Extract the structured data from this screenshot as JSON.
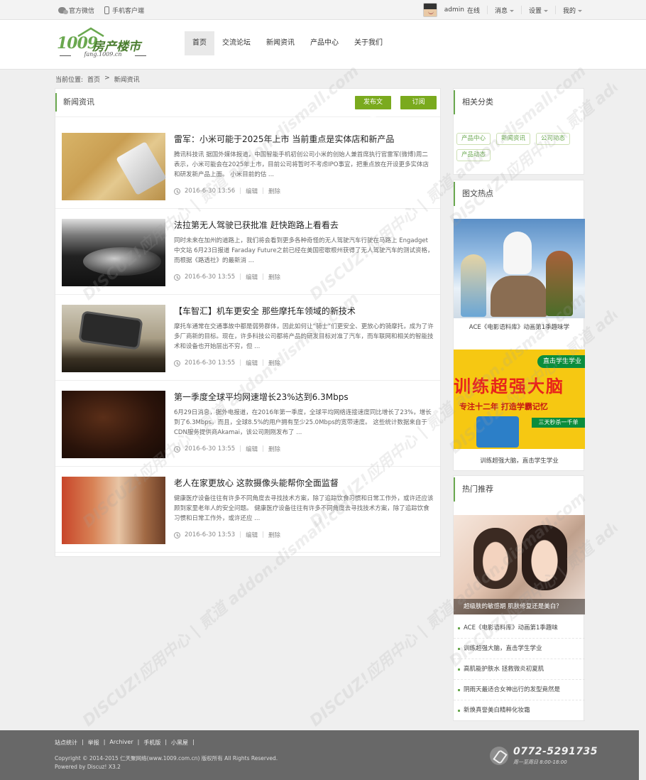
{
  "topbar": {
    "wechat": "官方微信",
    "mobile": "手机客户端",
    "username": "admin",
    "status": "在线",
    "messages": "消息",
    "settings": "设置",
    "mine": "我的"
  },
  "header": {
    "logo_main": "1009",
    "logo_cn": "房产楼市",
    "logo_sub": "fang.1009.cn",
    "nav": [
      "首页",
      "交流论坛",
      "新闻资讯",
      "产品中心",
      "关于我们"
    ]
  },
  "breadcrumb": {
    "label": "当前位置:",
    "home": "首页",
    "current": "新闻资讯",
    "sep": ">"
  },
  "main": {
    "title": "新闻资讯",
    "publish_button": "发布文章",
    "subscribe_button": "订阅",
    "edit": "编辑",
    "delete": "删除",
    "articles": [
      {
        "title": "雷军：小米可能于2025年上市 当前重点是实体店和新产品",
        "summary": "腾讯科技讯 据国外媒体报道，中国智能手机初创公司小米的创始人兼首席执行官雷军(微博)周二表示，小米可能会在2025年上市，目前公司将暂时不考虑IPO事宜，把重点放在开设更多实体店和研发新产品上面。 小米目前的估 ...",
        "time": "2016-6-30 13:56"
      },
      {
        "title": "法拉第无人驾驶已获批准 赶快跑路上看看去",
        "summary": "同时未来在加州的道路上，我们将会看到更多各种奇怪的无人驾驶汽车行驶在马路上 Engadget中文站 6月23日报道 Faraday Future之前已经在美国密歇根州获得了无人驾驶汽车的测试资格，而根据《路透社》的最新消 ...",
        "time": "2016-6-30 13:55"
      },
      {
        "title": "【车智汇】机车更安全 那些摩托车领域的新技术",
        "summary": "摩托车通常在交通事故中都是弱势群体，因此如何让“骑士”们更安全、更放心的骑摩托，成为了许多厂商新的目标。现在，许多科技公司都将产品的研发目标对准了汽车，而车联网和相关的智能技术和设备也开始层出不穷，但 ...",
        "time": "2016-6-30 13:55"
      },
      {
        "title": "第一季度全球平均网速增长23%达到6.3Mbps",
        "summary": "6月29日消息，据外电报道，在2016年第一季度，全球平均网络连接速度同比增长了23%，增长到了6.3Mbps。而且，全球8.5%的用户拥有至少25.0Mbps的宽带速度。 这些统计数据来自于CDN服务提供商Akamai，该公司刚刚发布了 ...",
        "time": "2016-6-30 13:55"
      },
      {
        "title": "老人在家更放心 这款摄像头能帮你全面监督",
        "summary": "健康医疗设备往往有许多不同角度去寻找技术方案，除了追踪饮食习惯和日常工作外，或许还应该顾到家里老年人的安全问题。 健康医疗设备往往有许多不同角度去寻找技术方案，除了追踪饮食习惯和日常工作外，或许还应 ...",
        "time": "2016-6-30 13:53"
      }
    ]
  },
  "sidebar": {
    "related_title": "相关分类",
    "tags": [
      "产品中心",
      "新闻资讯",
      "公司动态",
      "产品动态"
    ],
    "picture_title": "图文热点",
    "pictures": [
      {
        "caption": "ACE《电影语料库》动画第1季趣味学"
      },
      {
        "caption": "训练超强大脑，直击学生学业",
        "banner_line1": "训练超强大脑",
        "banner_line2": "专注十二年  打造学霸记忆",
        "banner_tag": "直击学生学业",
        "banner_small": "三天秒杀一千单"
      }
    ],
    "hot_title": "热门推荐",
    "hot_image_caption": "超级肤的敏感期 肌肤修复还是美白？",
    "hot_list": [
      "ACE《电影语料库》动画第1季趣味",
      "训练超强大脑，直击学生学业",
      "高肌能护肤水 拯救微炎初夏肌",
      "阴雨天最适合女神出行的发型竟然是",
      "新焕真誉美白精粹化妆霜"
    ]
  },
  "footer": {
    "links": [
      "站点统计",
      "举报",
      "Archiver",
      "手机版",
      "小黑屋"
    ],
    "copyright": "Copyright © 2014-2015 仁天聚网络(www.1009.com.cn) 版权所有 All Rights Reserved.",
    "powered": "Powered by Discuz! X3.2",
    "phone": "0772-5291735",
    "hours": "周一至周日  8:00-18:00"
  },
  "watermark": "DISCUZ!应用中心 | 贰道  addon.dismall.com",
  "colors": {
    "accent": "#6aa84f",
    "button": "#7aaa1e",
    "footer": "#686868"
  }
}
